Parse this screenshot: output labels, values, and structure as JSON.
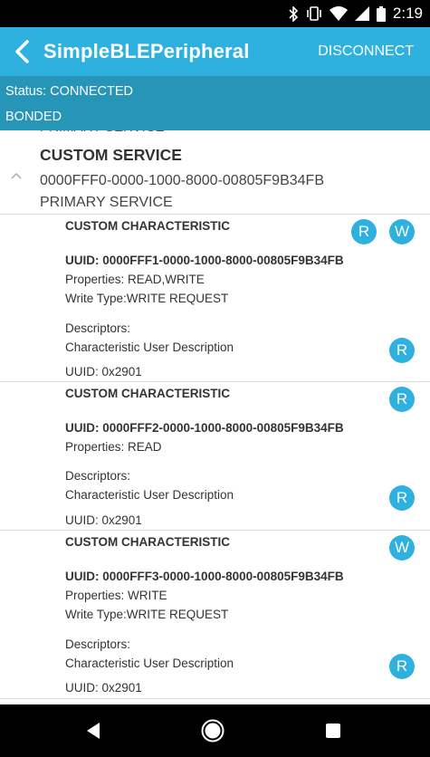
{
  "status_bar": {
    "time": "2:19",
    "icons": [
      "bluetooth-icon",
      "vibrate-icon",
      "wifi-icon",
      "signal-icon",
      "battery-icon"
    ]
  },
  "app_bar": {
    "title": "SimpleBLEPeripheral",
    "action": "DISCONNECT"
  },
  "connection": {
    "status": "Status: CONNECTED",
    "bond": "BONDED"
  },
  "previous_service_type": "PRIMARY SERVICE",
  "service": {
    "name": "CUSTOM SERVICE",
    "uuid": "0000FFF0-0000-1000-8000-00805F9B34FB",
    "type": "PRIMARY SERVICE"
  },
  "characteristics": [
    {
      "name": "CUSTOM CHARACTERISTIC",
      "uuid": "UUID: 0000FFF1-0000-1000-8000-00805F9B34FB",
      "properties": "Properties: READ,WRITE",
      "write_type": "Write Type:WRITE REQUEST",
      "descriptors_label": "Descriptors:",
      "descriptor_name": "Characteristic User Description",
      "descriptor_uuid": "UUID: 0x2901",
      "buttons": [
        "R",
        "W"
      ],
      "descriptor_button": "R"
    },
    {
      "name": "CUSTOM CHARACTERISTIC",
      "uuid": "UUID: 0000FFF2-0000-1000-8000-00805F9B34FB",
      "properties": "Properties: READ",
      "descriptors_label": "Descriptors:",
      "descriptor_name": "Characteristic User Description",
      "descriptor_uuid": "UUID: 0x2901",
      "buttons": [
        "R"
      ],
      "descriptor_button": "R"
    },
    {
      "name": "CUSTOM CHARACTERISTIC",
      "uuid": "UUID: 0000FFF3-0000-1000-8000-00805F9B34FB",
      "properties": "Properties: WRITE",
      "write_type": "Write Type:WRITE REQUEST",
      "descriptors_label": "Descriptors:",
      "descriptor_name": "Characteristic User Description",
      "descriptor_uuid": "UUID: 0x2901",
      "buttons": [
        "W"
      ],
      "descriptor_button": "R"
    }
  ],
  "nav_bar": {
    "buttons": [
      "back-icon",
      "home-icon",
      "recents-icon"
    ]
  },
  "colors": {
    "app_bar": "#2eb1df",
    "status_panel": "#2795b8",
    "action_button": "#2eb1df"
  }
}
